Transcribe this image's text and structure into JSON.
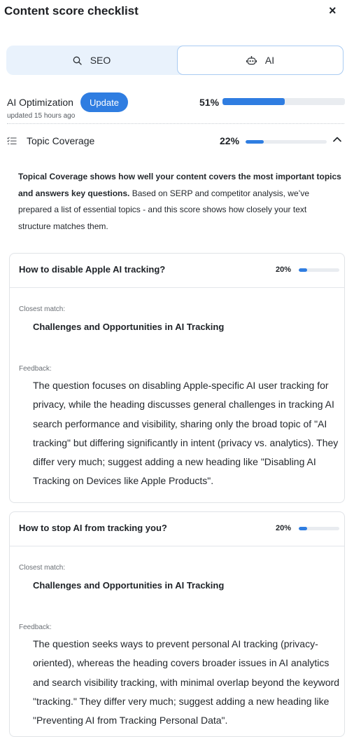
{
  "header": {
    "title": "Content score checklist",
    "close_glyph": "×",
    "close_icon": "close-icon"
  },
  "tabs": [
    {
      "label": "SEO",
      "icon": "search-icon",
      "active": false
    },
    {
      "label": "AI",
      "icon": "robot-icon",
      "active": true
    }
  ],
  "ai_optimization": {
    "title": "AI Optimization",
    "update_label": "Update",
    "updated_text": "updated 15 hours ago",
    "score_text": "51%",
    "score": 0.51
  },
  "topic_coverage": {
    "icon": "list-check-icon",
    "label": "Topic Coverage",
    "score_text": "22%",
    "score": 0.22,
    "expanded_icon": "chevron-up-icon"
  },
  "description": {
    "bold": "Topical Coverage shows how well your content covers the most important topics and answers key questions.",
    "rest": " Based on SERP and competitor analysis, we’ve prepared a list of essential topics - and this score shows how closely your text structure matches them."
  },
  "questions": [
    {
      "question": "How to disable Apple AI tracking?",
      "score_text": "20%",
      "score": 0.2,
      "closest_label": "Closest match:",
      "closest": "Challenges and Opportunities in AI Tracking",
      "feedback_label": "Feedback:",
      "feedback": "The question focuses on disabling Apple-specific AI user tracking for privacy, while the heading discusses general challenges in tracking AI search performance and visibility, sharing only the broad topic of \"AI tracking\" but differing significantly in intent (privacy vs. analytics). They differ very much; suggest adding a new heading like \"Disabling AI Tracking on Devices like Apple Products\"."
    },
    {
      "question": "How to stop AI from tracking you?",
      "score_text": "20%",
      "score": 0.2,
      "closest_label": "Closest match:",
      "closest": "Challenges and Opportunities in AI Tracking",
      "feedback_label": "Feedback:",
      "feedback": "The question seeks ways to prevent personal AI tracking (privacy-oriented), whereas the heading covers broader issues in AI analytics and search visibility tracking, with minimal overlap beyond the keyword \"tracking.\" They differ very much; suggest adding a new heading like \"Preventing AI from Tracking Personal Data\"."
    }
  ],
  "colors": {
    "accent": "#2f7de1",
    "tab_bg": "#e9f2fc",
    "bar_track": "#e9ecf0"
  }
}
